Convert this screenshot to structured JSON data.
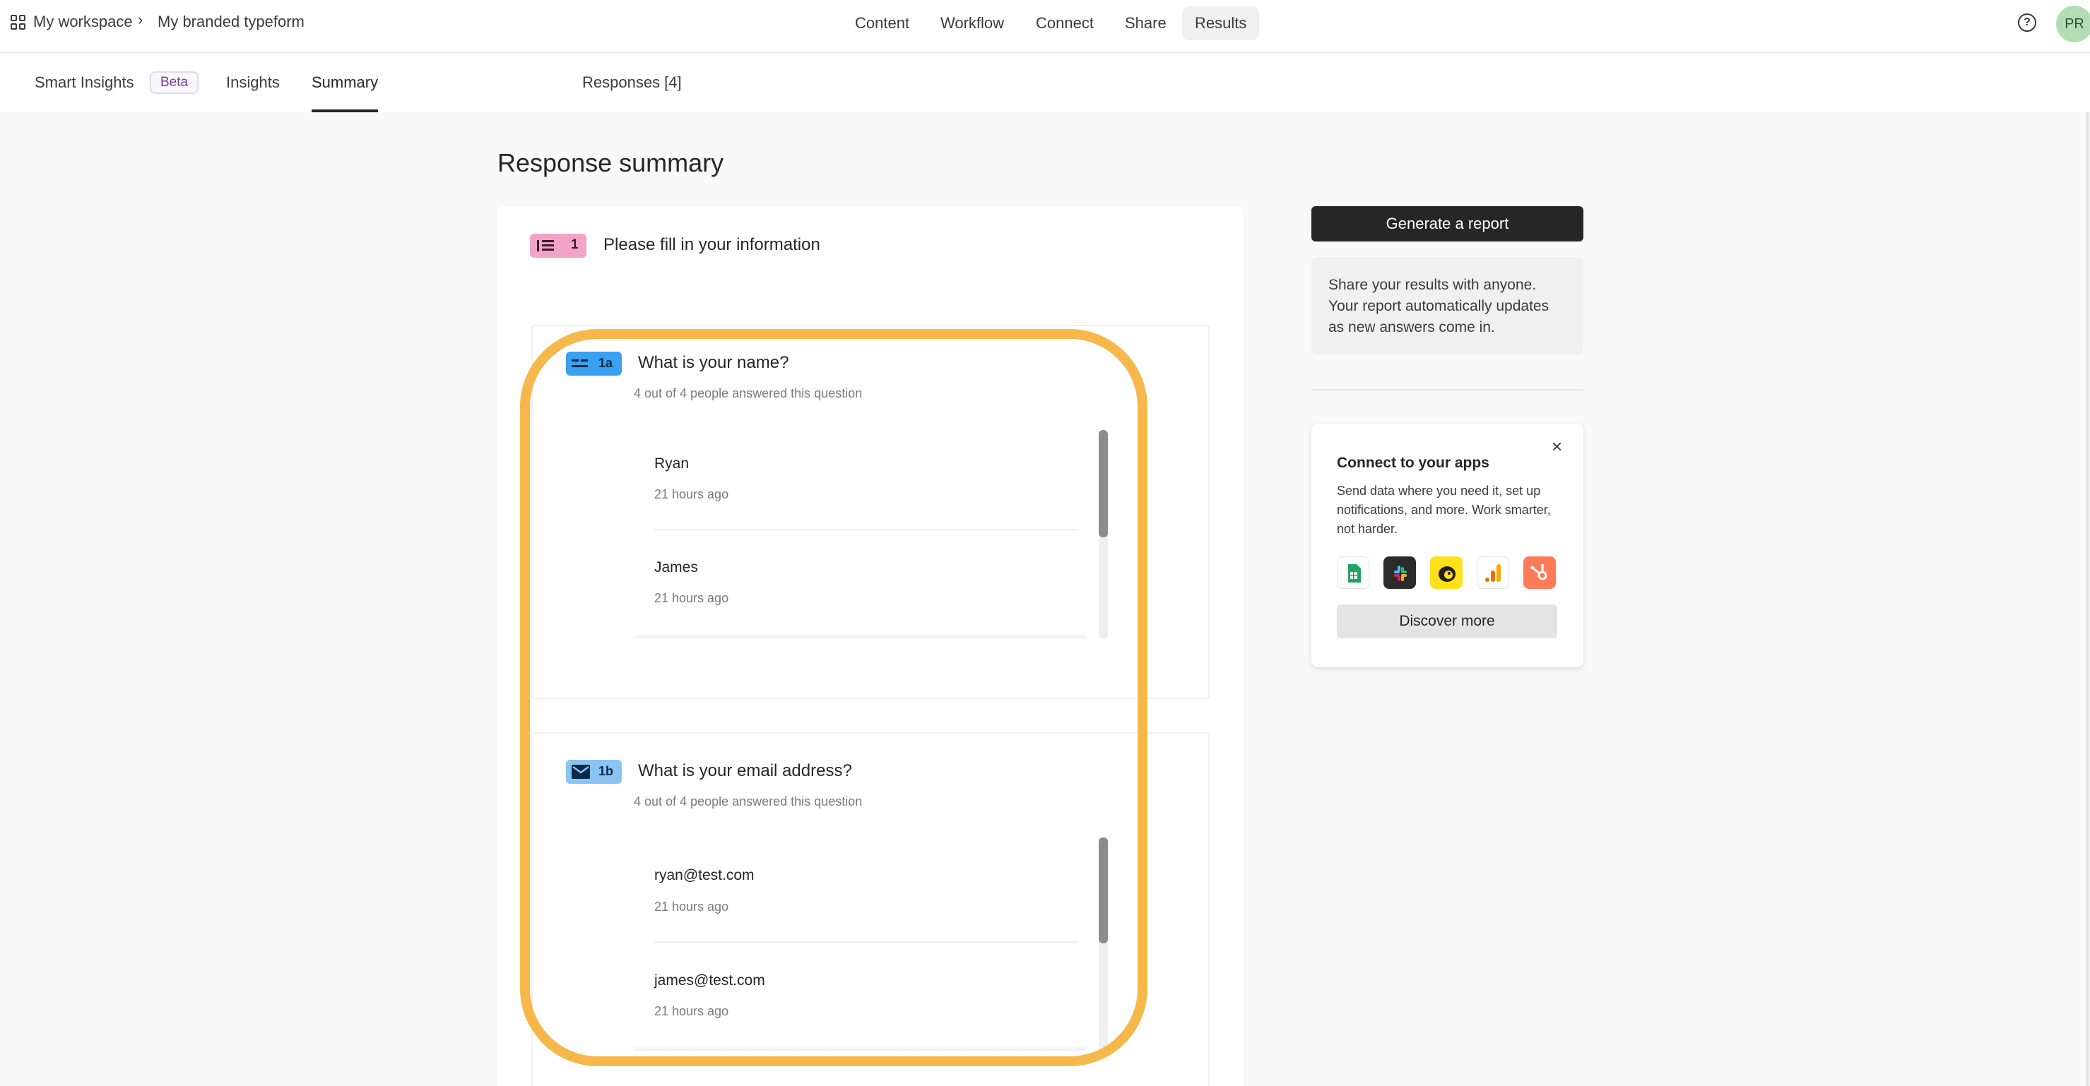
{
  "topbar": {
    "workspace": "My workspace",
    "separator": "›",
    "form_name": "My branded typeform",
    "nav": [
      "Content",
      "Workflow",
      "Connect",
      "Share",
      "Results"
    ],
    "active_nav": "Results",
    "avatar_initials": "PR"
  },
  "subnav": {
    "smart_insights": "Smart Insights",
    "beta": "Beta",
    "insights": "Insights",
    "summary": "Summary",
    "responses": "Responses [4]",
    "active": "Summary"
  },
  "main": {
    "title": "Response summary",
    "group": {
      "number": "1",
      "title": "Please fill in your information",
      "color": "#f2a4c7"
    },
    "questions": [
      {
        "number": "1a",
        "title": "What is your name?",
        "subtitle": "4 out of 4 people answered this question",
        "icon": "short-text-icon",
        "color": "#3aa0f0",
        "answers": [
          {
            "value": "Ryan",
            "time": "21 hours ago"
          },
          {
            "value": "James",
            "time": "21 hours ago"
          }
        ]
      },
      {
        "number": "1b",
        "title": "What is your email address?",
        "subtitle": "4 out of 4 people answered this question",
        "icon": "envelope-icon",
        "color": "#8ac4f2",
        "answers": [
          {
            "value": "ryan@test.com",
            "time": "21 hours ago"
          },
          {
            "value": "james@test.com",
            "time": "21 hours ago"
          }
        ]
      }
    ]
  },
  "sidebar": {
    "generate_label": "Generate a report",
    "share_text": "Share your results with anyone. Your report automatically updates as new answers come in.",
    "connect": {
      "title": "Connect to your apps",
      "description": "Send data where you need it, set up notifications, and more. Work smarter, not harder.",
      "close": "×",
      "apps": [
        "google-sheets-icon",
        "slack-icon",
        "mailchimp-icon",
        "google-analytics-icon",
        "hubspot-icon"
      ],
      "discover_label": "Discover more"
    }
  },
  "colors": {
    "highlight": "#f7b84b",
    "accent_dark": "#262627"
  }
}
